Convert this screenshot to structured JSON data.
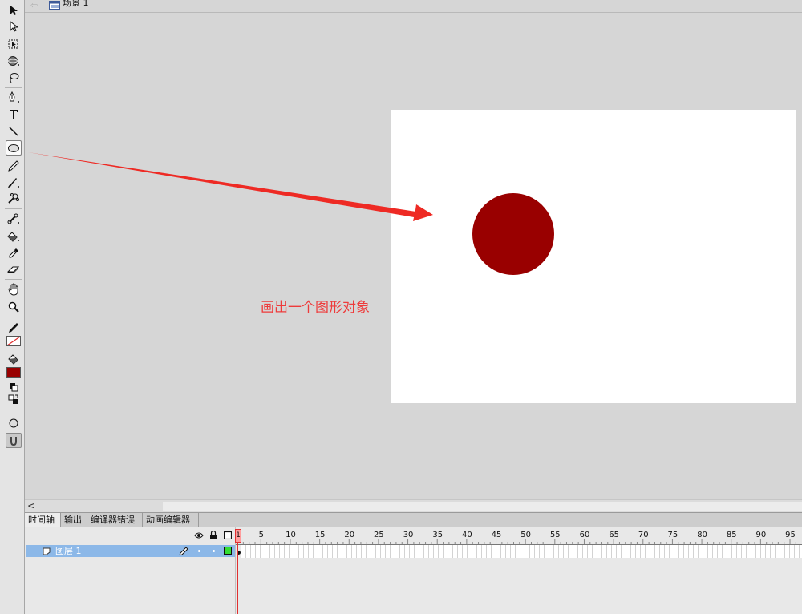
{
  "edit_bar": {
    "scene_label": "场景 1"
  },
  "annotation": {
    "text": "画出一个图形对象",
    "color": "#ee3b3b"
  },
  "stage": {
    "background": "#ffffff",
    "shape_fill": "#990000"
  },
  "toolbar": {
    "tools": [
      "selection-tool-icon",
      "subselection-tool-icon",
      "free-transform-tool-icon",
      "3d-rotation-tool-icon",
      "lasso-tool-icon",
      "pen-tool-icon",
      "text-tool-icon",
      "line-tool-icon",
      "oval-tool-icon",
      "pencil-tool-icon",
      "brush-tool-icon",
      "deco-tool-icon",
      "bone-tool-icon",
      "paint-bucket-tool-icon",
      "eyedropper-tool-icon",
      "eraser-tool-icon",
      "hand-tool-icon",
      "zoom-tool-icon"
    ],
    "stroke_color": "none",
    "fill_color": "#990000",
    "options": [
      "object-drawing-icon",
      "snap-to-objects-icon"
    ]
  },
  "scrollbar": {
    "left_arrow": "<"
  },
  "panel_tabs": [
    "时间轴",
    "输出",
    "编译器错误",
    "动画编辑器"
  ],
  "timeline": {
    "ruler_numbers": [
      "1",
      "5",
      "10",
      "15",
      "20",
      "25",
      "30",
      "35",
      "40",
      "45",
      "50",
      "55",
      "60",
      "65",
      "70",
      "75",
      "80",
      "85",
      "90",
      "95"
    ],
    "current_frame": "1",
    "layers": [
      {
        "name": "图层 1"
      }
    ]
  }
}
